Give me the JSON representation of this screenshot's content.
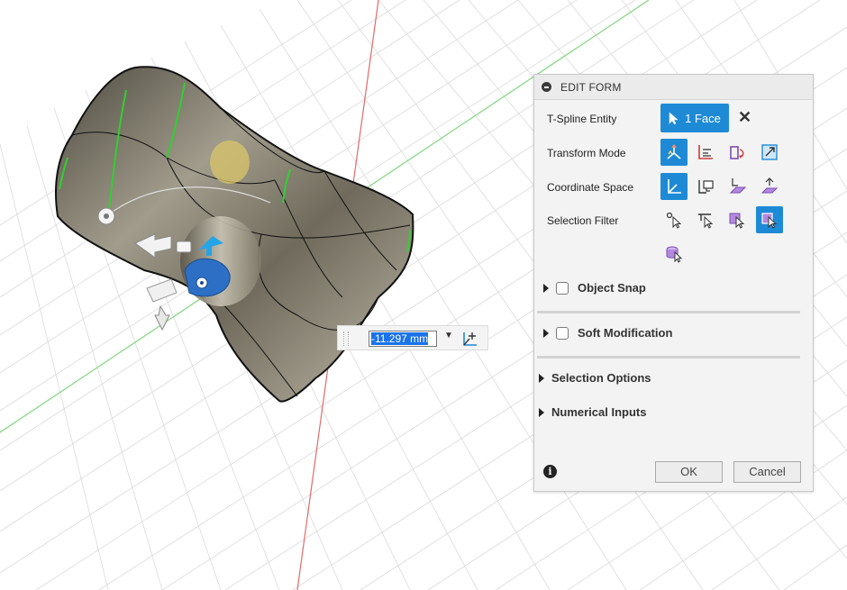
{
  "panel": {
    "title": "EDIT FORM",
    "rows": {
      "tspline_label": "T-Spline Entity",
      "transform_label": "Transform Mode",
      "coord_label": "Coordinate Space",
      "filter_label": "Selection Filter"
    },
    "tspline_value": "1 Face",
    "icons": {
      "transform": [
        "multi-transform-icon",
        "translate-axes-icon",
        "rotate-icon",
        "scale-icon"
      ],
      "coordinate": [
        "world-space-icon",
        "view-space-icon",
        "local-space-icon",
        "per-face-space-icon"
      ],
      "filter": [
        "select-vertex-icon",
        "select-edge-icon",
        "select-face-icon",
        "select-all-icon",
        "select-body-icon"
      ]
    },
    "sections": {
      "object_snap": "Object Snap",
      "soft_modification": "Soft Modification",
      "selection_options": "Selection Options",
      "numerical_inputs": "Numerical Inputs"
    },
    "buttons": {
      "ok": "OK",
      "cancel": "Cancel"
    }
  },
  "value_input": {
    "value": "-11.297 mm"
  },
  "colors": {
    "accent": "#1e8ad6",
    "model": "#7d7866",
    "grid": "#d9d9d9"
  }
}
